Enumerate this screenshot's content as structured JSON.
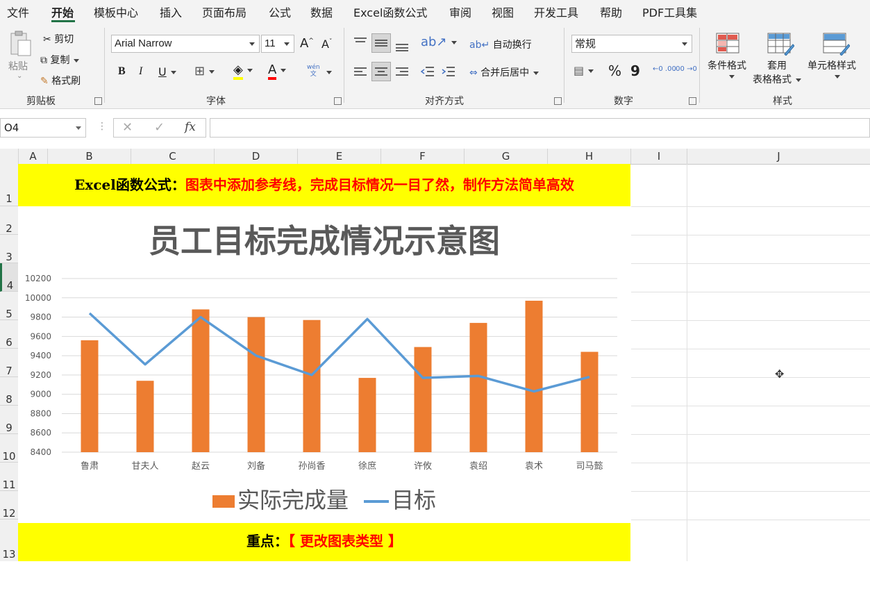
{
  "menu": {
    "tabs": [
      "文件",
      "开始",
      "模板中心",
      "插入",
      "页面布局",
      "公式",
      "数据",
      "Excel函数公式",
      "审阅",
      "视图",
      "开发工具",
      "帮助",
      "PDF工具集"
    ],
    "active": "开始"
  },
  "clipboard": {
    "paste": "粘贴",
    "cut": "剪切",
    "copy": "复制",
    "format_painter": "格式刷",
    "group": "剪贴板"
  },
  "font": {
    "name": "Arial Narrow",
    "size": "11",
    "bold": "B",
    "italic": "I",
    "underline": "U",
    "phonetic_top": "wén",
    "phonetic_bottom": "文",
    "color_letter": "A",
    "group": "字体"
  },
  "alignment": {
    "wrap": "自动换行",
    "merge": "合并后居中",
    "group": "对齐方式"
  },
  "number": {
    "format": "常规",
    "percent": "%",
    "comma": "9",
    "group": "数字",
    "inc_decimal": "←0 .00",
    "dec_decimal": ".00 →0"
  },
  "styles": {
    "conditional": "条件格式",
    "table_l1": "套用",
    "table_l2": "表格格式",
    "cell": "单元格样式",
    "group": "样式"
  },
  "formula": {
    "cell_ref": "O4",
    "fx": "fx",
    "value": ""
  },
  "columns": [
    "A",
    "B",
    "C",
    "D",
    "E",
    "F",
    "G",
    "H",
    "I",
    "J"
  ],
  "rows": [
    "1",
    "2",
    "3",
    "4",
    "5",
    "6",
    "7",
    "8",
    "9",
    "10",
    "11",
    "12",
    "13"
  ],
  "banner_top": {
    "prefix": "Excel函数公式：",
    "text": "图表中添加参考线，完成目标情况一目了然，制作方法简单高效"
  },
  "banner_bottom": {
    "prefix": "重点：",
    "text": "【 更改图表类型 】"
  },
  "colors": {
    "bar": "#ed7d31",
    "line": "#5b9bd5",
    "banner": "#ffff00",
    "accent": "#217346",
    "red": "#ff0000"
  },
  "chart_data": {
    "type": "bar",
    "title": "员工目标完成情况示意图",
    "categories": [
      "鲁肃",
      "甘夫人",
      "赵云",
      "刘备",
      "孙尚香",
      "徐庶",
      "许攸",
      "袁绍",
      "袁术",
      "司马懿"
    ],
    "series": [
      {
        "name": "实际完成量",
        "type": "bar",
        "values": [
          9560,
          9140,
          9880,
          9800,
          9770,
          9170,
          9490,
          9740,
          9970,
          9440
        ]
      },
      {
        "name": "目标",
        "type": "line",
        "values": [
          9840,
          9310,
          9800,
          9400,
          9200,
          9780,
          9170,
          9190,
          9030,
          9180
        ]
      }
    ],
    "ylim": [
      8400,
      10200
    ],
    "yticks": [
      8400,
      8600,
      8800,
      9000,
      9200,
      9400,
      9600,
      9800,
      10000,
      10200
    ],
    "grid": true,
    "legend": "bottom"
  }
}
